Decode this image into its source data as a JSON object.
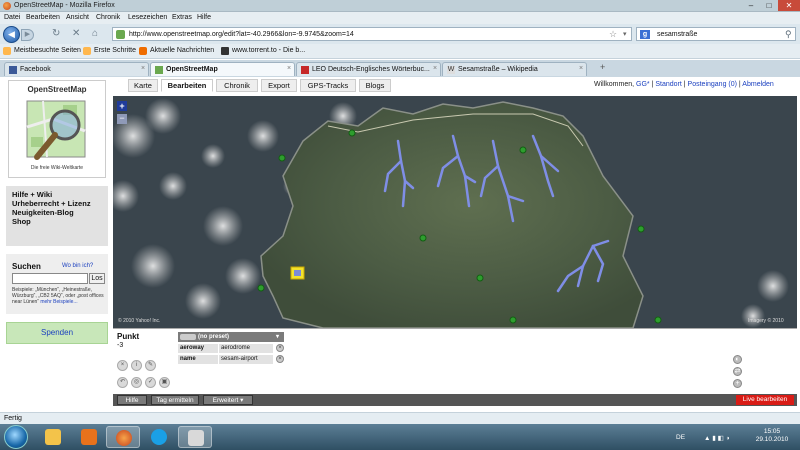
{
  "window": {
    "title": "OpenStreetMap - Mozilla Firefox",
    "min": "–",
    "max": "□",
    "close": "✕"
  },
  "menu": [
    "Datei",
    "Bearbeiten",
    "Ansicht",
    "Chronik",
    "Lesezeichen",
    "Extras",
    "Hilfe"
  ],
  "nav": {
    "url": "http://www.openstreetmap.org/edit?lat=-40.2966&lon=-9.9745&zoom=14",
    "search": "sesamstraße"
  },
  "bookmarks": [
    "Meistbesuchte Seiten",
    "Erste Schritte",
    "Aktuelle Nachrichten",
    "www.torrent.to - Die b..."
  ],
  "tabs": [
    {
      "label": "Facebook",
      "color": "#3b5998"
    },
    {
      "label": "OpenStreetMap",
      "color": "#6aa84f"
    },
    {
      "label": "LEO Deutsch-Englisches Wörterbuc...",
      "color": "#c62828"
    },
    {
      "label": "Sesamstraße – Wikipedia",
      "color": "#555555"
    }
  ],
  "sidebar": {
    "logo_title": "OpenStreetMap",
    "logo_subtitle": "Die freie Wiki-Weltkarte",
    "links": [
      "Hilfe + Wiki",
      "Urheberrecht + Lizenz",
      "Neuigkeiten-Blog",
      "Shop"
    ],
    "search_title": "Suchen",
    "where_am_i": "Wo bin ich?",
    "go": "Los",
    "examples": "Beispiele: „München“, „Heinestraße, Würzburg“, „CB2 5AQ“, oder „post offices near Lünen“",
    "more_examples": "mehr Beispiele...",
    "donate": "Spenden"
  },
  "pagetabs": [
    "Karte",
    "Bearbeiten",
    "Chronik",
    "Export",
    "GPS-Tracks",
    "Blogs"
  ],
  "user": {
    "welcome": "Willkommen,",
    "name": "GG*",
    "links": [
      "Standort",
      "Posteingang (0)",
      "Abmelden"
    ]
  },
  "map": {
    "zoom_in": "+",
    "zoom_out": "−",
    "copyright": "© 2010 Yahoo! Inc.",
    "imagery": "Imagery © 2010"
  },
  "editor": {
    "feature": "Punkt",
    "feature_id": "-3",
    "preset": "(no preset)",
    "tags": [
      {
        "key": "aeroway",
        "value": "aerodrome"
      },
      {
        "key": "name",
        "value": "sesam-airport"
      }
    ],
    "buttons": [
      "Hilfe",
      "Tag ermitteln",
      "Erweitert ▾"
    ],
    "live": "Live bearbeiten"
  },
  "status": "Fertig",
  "taskbar": {
    "lang": "DE",
    "time": "15:05",
    "date": "29.10.2010"
  }
}
